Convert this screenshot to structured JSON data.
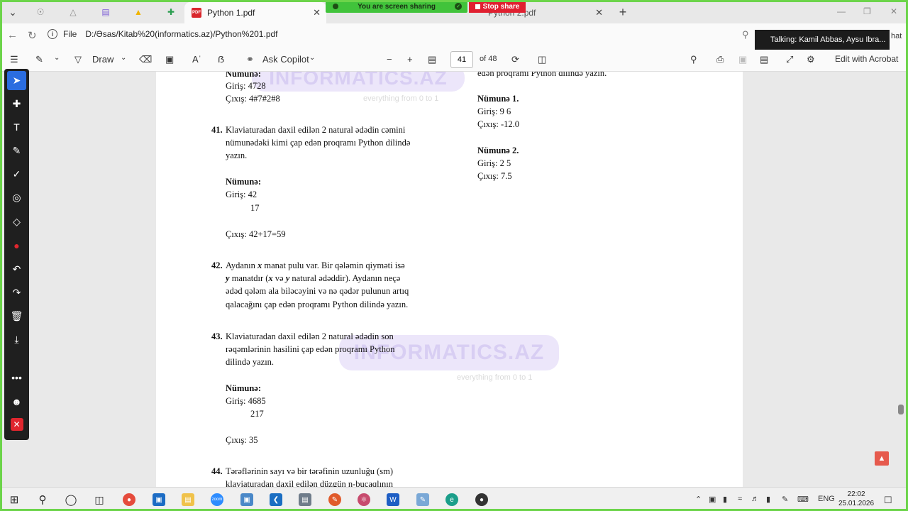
{
  "browser": {
    "active_tab_title": "Python 1.pdf",
    "second_tab_title": "Python 2.pdf",
    "url_prefix": "File",
    "url": "D:/Əsas/Kitab%20(informatics.az)/Python%201.pdf"
  },
  "share": {
    "banner": "You are screen sharing",
    "stop_label": "Stop share",
    "talking": "Talking: Kamil Abbas, Aysu Ibra...",
    "chat": "hat"
  },
  "pdf_toolbar": {
    "draw_label": "Draw",
    "copilot_label": "Ask Copilot",
    "page_current": "41",
    "page_total": "of 48",
    "acrobat_label": "Edit with Acrobat"
  },
  "watermark": {
    "brand": "INFORMATICS.AZ",
    "tagline": "everything from 0 to 1"
  },
  "content": {
    "top_example": {
      "heading": "Nümunə:",
      "input": "Giriş: 4728",
      "output": "Çıxış: 4#7#2#8"
    },
    "q41": {
      "num": "41.",
      "lines": [
        "Klaviaturadan daxil edilən 2 natural ədədin cəmini",
        "nümunədəki kimi çap edən proqramı Python dilində",
        "yazın."
      ],
      "heading": "Nümunə:",
      "input": "Giriş: 42",
      "input2": "17",
      "output": "Çıxış: 42+17=59"
    },
    "q42": {
      "num": "42.",
      "line1_a": "Aydanın ",
      "line1_x": "x",
      "line1_b": " manat pulu var. Bir qələmin qiyməti isə",
      "line2_y": "y",
      "line2_a": " manatdır (",
      "line2_x": "x",
      "line2_b": " və ",
      "line2_y2": "y",
      "line2_c": " natural ədəddir). Aydanın neçə",
      "line3": "ədəd qələm ala biləcəyini və nə qədər pulunun artıq",
      "line4": "qalacağını çap edən proqramı Python dilində yazın."
    },
    "q43": {
      "num": "43.",
      "lines": [
        "Klaviaturadan daxil edilən 2 natural ədədin son",
        "rəqəmlərinin hasilini çap edən proqramı Python",
        "dilində yazın."
      ],
      "heading": "Nümunə:",
      "input": "Giriş: 4685",
      "input2": "217",
      "output": "Çıxış: 35"
    },
    "q44": {
      "num": "44.",
      "line1": "Tərəflərinin sayı və bir tərəfinin uzunluğu (sm)",
      "line2": "klaviaturadan daxil edilən düzgün n-bucaqlının"
    },
    "right_col": {
      "top_line": "edən proqramı Python dilində yazın.",
      "ex1_heading": "Nümunə 1.",
      "ex1_input": "Giriş: 9 6",
      "ex1_output": "Çıxış: -12.0",
      "ex2_heading": "Nümunə 2.",
      "ex2_input": "Giriş: 2 5",
      "ex2_output": "Çıxış: 7.5"
    }
  },
  "taskbar": {
    "lang": "ENG",
    "time": "22:02",
    "date": "25.01.2026"
  }
}
